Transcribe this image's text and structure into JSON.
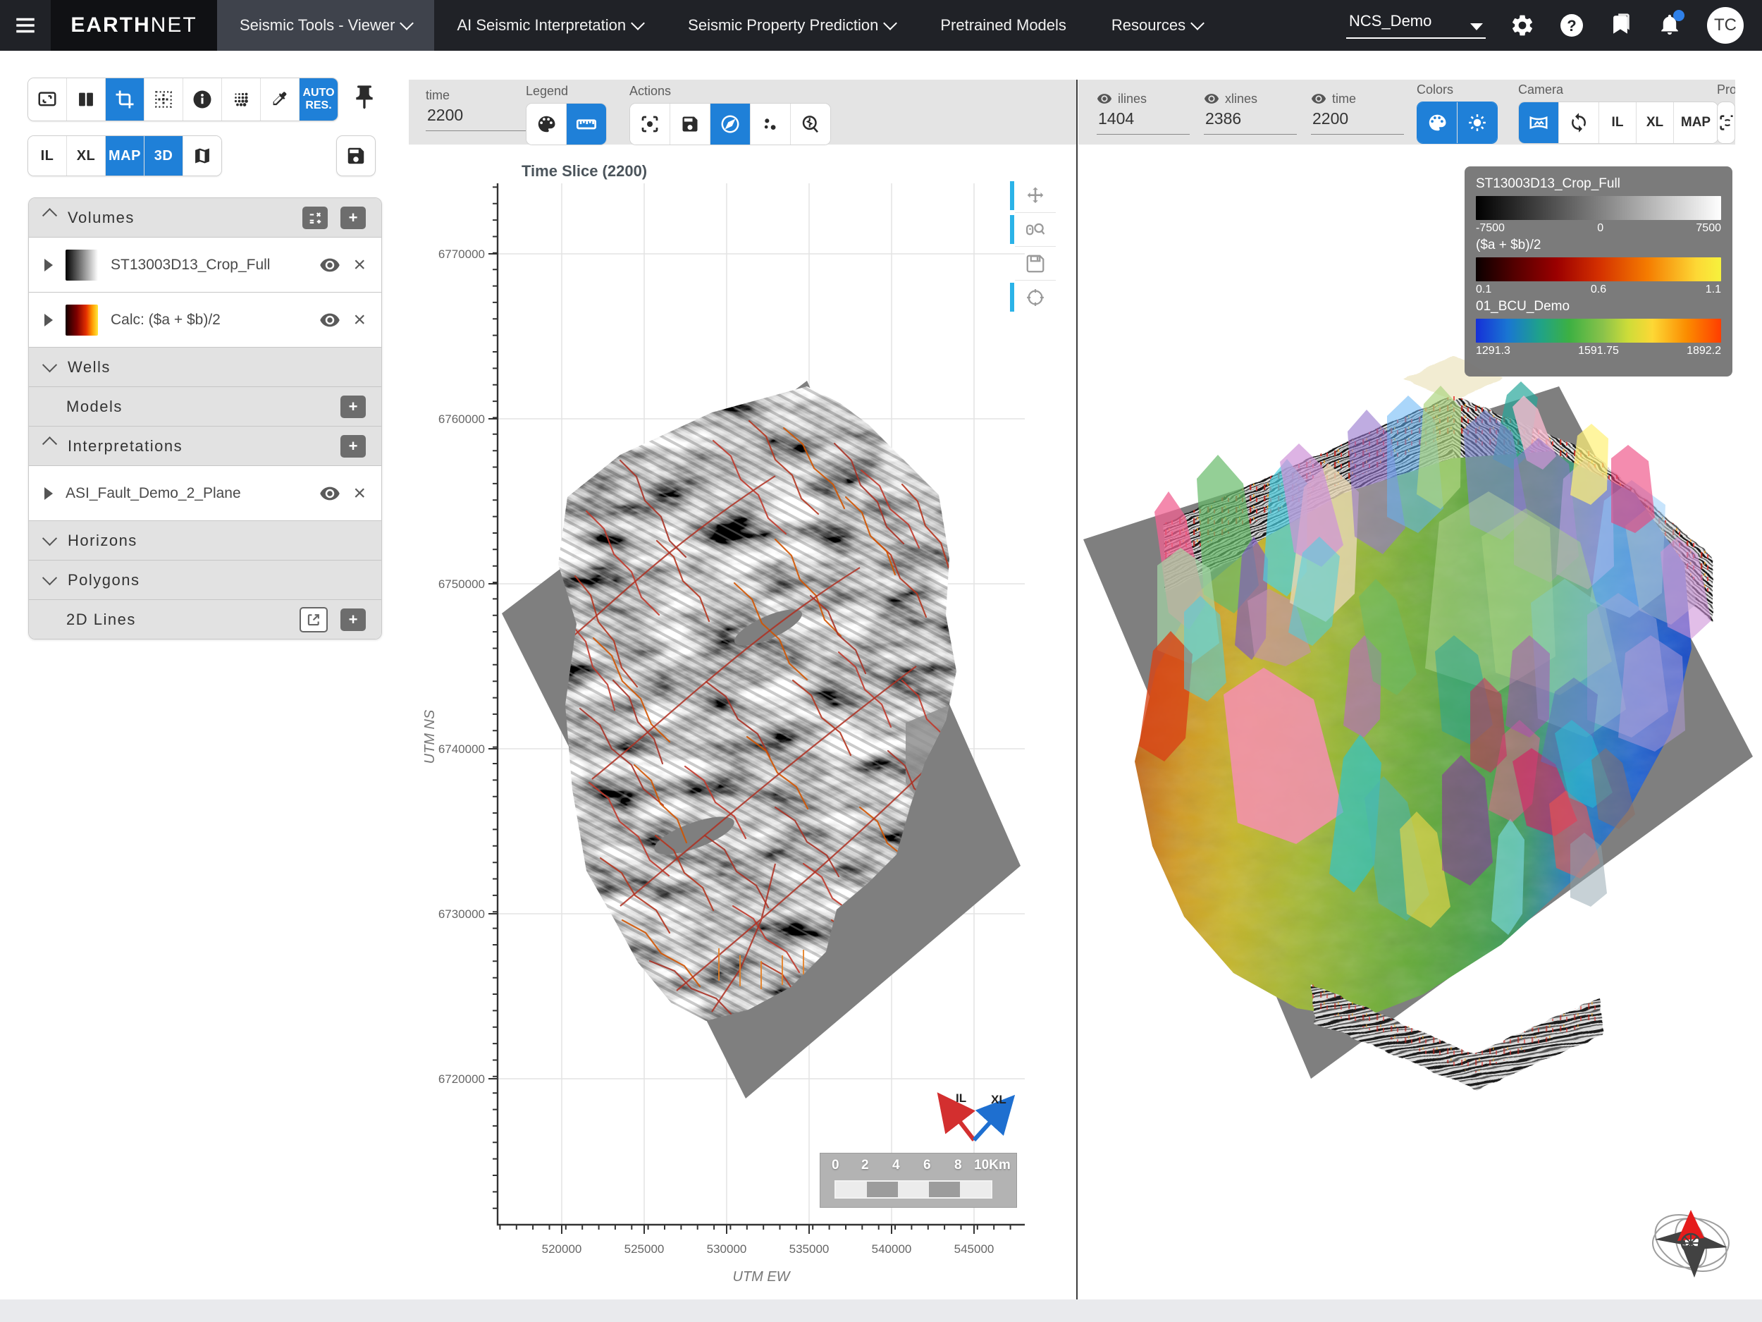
{
  "colors": {
    "accent": "#1f80d8",
    "nav_bg": "#202227",
    "modebar_blue": "#2bb3e8"
  },
  "nav": {
    "logo_bold": "EARTH",
    "logo_light": "NET",
    "items": [
      {
        "label": "Seismic Tools - Viewer"
      },
      {
        "label": "AI Seismic Interpretation"
      },
      {
        "label": "Seismic Property Prediction"
      },
      {
        "label": "Pretrained Models"
      },
      {
        "label": "Resources"
      }
    ],
    "workspace": "NCS_Demo",
    "help_glyph": "?",
    "avatar": "TC"
  },
  "toolbar": {
    "auto_line1": "AUTO",
    "auto_line2": "RES.",
    "il": "IL",
    "xl": "XL",
    "map": "MAP",
    "d3": "3D"
  },
  "sidebar": {
    "volumes": {
      "label": "Volumes",
      "items": [
        {
          "name": "ST13003D13_Crop_Full"
        },
        {
          "name": "Calc: ($a + $b)/2"
        }
      ]
    },
    "wells": {
      "label": "Wells"
    },
    "models": {
      "label": "Models"
    },
    "interpretations": {
      "label": "Interpretations",
      "items": [
        {
          "name": "ASI_Fault_Demo_2_Plane"
        }
      ]
    },
    "horizons": {
      "label": "Horizons"
    },
    "polygons": {
      "label": "Polygons"
    },
    "lines2d": {
      "label": "2D Lines"
    }
  },
  "map_panel": {
    "time_label": "time",
    "time_value": "2200",
    "legend_label": "Legend",
    "actions_label": "Actions",
    "plot": {
      "title": "Time Slice (2200)",
      "xlabel": "UTM EW",
      "ylabel": "UTM NS",
      "x_ticks": [
        "520000",
        "525000",
        "530000",
        "535000",
        "540000",
        "545000"
      ],
      "y_ticks": [
        "6770000",
        "6760000",
        "6750000",
        "6740000",
        "6730000",
        "6720000"
      ]
    },
    "scalebar_labels": [
      "0",
      "2",
      "4",
      "6",
      "8",
      "10Km"
    ],
    "il": "IL",
    "xl": "XL"
  },
  "view3d": {
    "ilines_label": "ilines",
    "ilines_value": "1404",
    "xlines_label": "xlines",
    "xlines_value": "2386",
    "time_label": "time",
    "time_value": "2200",
    "colors_label": "Colors",
    "camera_label": "Camera",
    "projection_label": "Pro",
    "camera_views": [
      "IL",
      "XL",
      "MAP"
    ],
    "legend": [
      {
        "name": "ST13003D13_Crop_Full",
        "t0": "-7500",
        "t1": "0",
        "t2": "7500"
      },
      {
        "name": "($a + $b)/2",
        "t0": "0.1",
        "t1": "0.6",
        "t2": "1.1"
      },
      {
        "name": "01_BCU_Demo",
        "t0": "1291.3",
        "t1": "1591.75",
        "t2": "1892.2"
      }
    ]
  }
}
